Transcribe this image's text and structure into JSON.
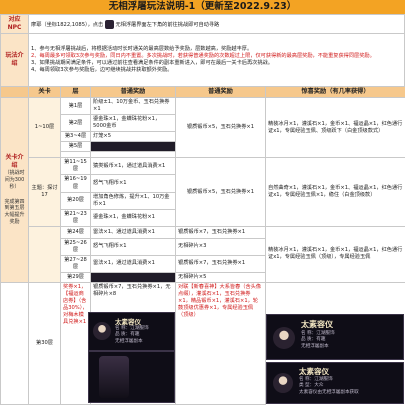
{
  "title": "无相浮屠玩法说明-1（更新至2022.9.23）",
  "intro": {
    "label": "对应NPC",
    "text": "摩耶（坐标1822,1085），点击",
    "text2": "无相浮屠界面左下角的前往挑战即可自动寻路"
  },
  "rules": {
    "label": "玩法介绍",
    "items": [
      "1、参与无相浮屠挑战后，将根据活动时长时通关的最高层数给予奖励，层数越高，奖励越丰厚。",
      "2、每周最多可领取3次参与奖励，同日内不重置。多次挑战时，若获得普通奖励的次数超过上限，仅可获得新的最高层奖励，不能重复获得同层奖励。",
      "3、如果挑战期间满足条件，可以通过前往查看满足条件的副本重新进入，即可在最后一关卡后再次挑战。",
      "4、每周领取3次参与奖励后，边可继续挑战并获取额外奖励。"
    ]
  },
  "table": {
    "headers": [
      "关卡",
      "层",
      "普通奖励",
      "普通奖励",
      "惊喜奖励（有几率获得）"
    ],
    "section_label": "关卡介绍",
    "section_sub": "（挑战时间为300秒）",
    "group1": "1~10层",
    "group2": "主题：探讨17",
    "group3": "完成第四到第五层大幅提升奖励",
    "rows": [
      {
        "floor": "第1层",
        "n1": "阶级±1、10万金币、玉石兑换券×1",
        "n2": "",
        "s": ""
      },
      {
        "floor": "第2层",
        "n1": "鎏金珠×1，金蝶珠花粉×1，5000金币",
        "n2": "银质锻币×5，玉石兑换券×1",
        "s": "精装冰月×1，灌溪石×1，金币×1、福运晶×1，红色通行证x1，专属经验玉佩、顶级跃下（白金顶级款式）"
      },
      {
        "floor": "第3~4层",
        "n1": "灯笼×5",
        "n2": "",
        "s": ""
      },
      {
        "floor": "第5层",
        "n1": "",
        "n2": "",
        "s": ""
      },
      {
        "floor": "第11~15层",
        "n1": "猿类锻币×1，通过道具消费×1",
        "n2": "",
        "s": ""
      },
      {
        "floor": "第16~19层",
        "n1": "怒气飞翔币×1",
        "n2": "银质锻币×5，玉石兑换券×1",
        "s": "自然曲奇×1，灌溪石×1，金币×1、福运晶×1，红色通行证x1，专属经验玉佩×1，稳住（白金顶级款）"
      },
      {
        "floor": "第20层",
        "n1": "增加角色修炼，提升×1、10万金币×1",
        "n2": "",
        "s": ""
      },
      {
        "floor": "第21~23层",
        "n1": "鎏金珠×1，金蝶珠花粉×1",
        "n2": "",
        "s": ""
      },
      {
        "floor": "第24层",
        "n1": "雷法×1、通过道具消费×1",
        "n2": "银质锻币×7，玉石兑换券×1",
        "s": "精装冰月×1，灌溪石×1，金币×1，福运晶×1，红色通行证x1，专属经验玉佩（顶级），专属经验玉佩"
      },
      {
        "floor": "第25~26层",
        "n1": "怒气飞翔币×1",
        "n2": "无相碎片×3",
        "s": ""
      },
      {
        "floor": "第27~28层",
        "n1": "雷法×1，通过道具消费×1",
        "n2": "银质锻币×7，玉石兑换券×1",
        "s": ""
      },
      {
        "floor": "第29层",
        "n1": "",
        "n2": "无相碎片×5",
        "s": ""
      },
      {
        "floor": "第30层",
        "n1": "奖券×1，【福运商店券】（含品30%），对梅木模具兑换×1",
        "n2": "银质锻币×7，玉石兑换券×1，无相碎片×8",
        "s": "对联【新春喜神】大系皆春（含头像点缀），灌溪石×1，玉石兑换券×1，精品锻币×1，灌溪石×1，轮鼓顶级优惠券×1，专属经验玉佩（顶级）"
      }
    ],
    "cards": [
      {
        "name": "太素容仪",
        "lines": [
          "名 称：江湖服饰",
          "品 质：有趣"
        ],
        "caption": "无相浮屠副本"
      },
      {
        "name": "太素容仪",
        "lines": [
          "名 称：江湖服饰",
          "品 质：有趣"
        ],
        "caption": "无相浮屠副本"
      },
      {
        "name": "太素容仪",
        "lines": [
          "名 称：江湖服饰",
          "类 型：大众"
        ],
        "caption": "太素容仪由无相浮屠副本获取"
      }
    ]
  },
  "colors": {
    "banner": "#f3a323",
    "label_bg": "#fbe4c6",
    "header_bg": "#f6c88c",
    "accent_red": "#d01818"
  }
}
